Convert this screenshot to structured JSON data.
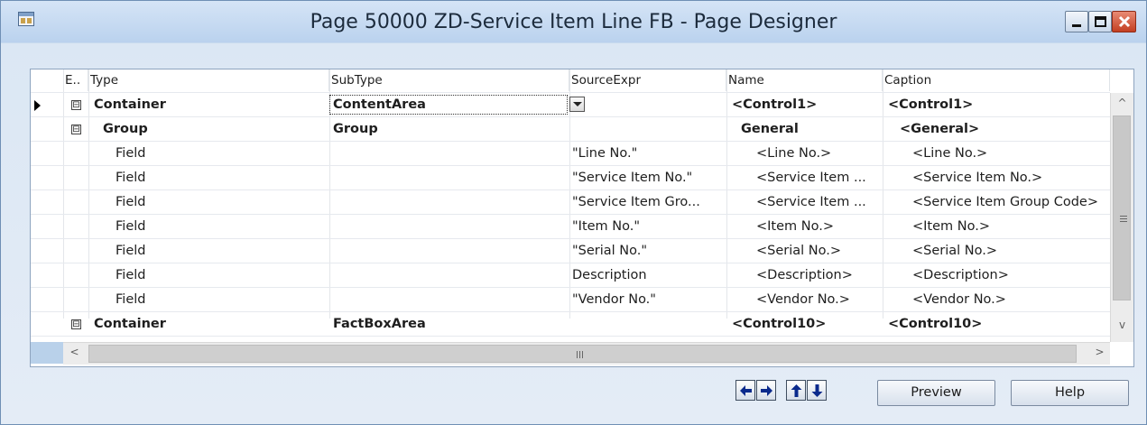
{
  "window": {
    "title": "Page 50000 ZD-Service Item Line FB - Page Designer",
    "icons": {
      "app": "page-designer-icon",
      "minimize": "minimize-icon",
      "maximize": "maximize-icon",
      "close": "close-icon"
    }
  },
  "grid": {
    "columns": [
      {
        "key": "expand",
        "label": "E.."
      },
      {
        "key": "type",
        "label": "Type"
      },
      {
        "key": "subtype",
        "label": "SubType"
      },
      {
        "key": "sourceexpr",
        "label": "SourceExpr"
      },
      {
        "key": "name",
        "label": "Name"
      },
      {
        "key": "caption",
        "label": "Caption"
      }
    ],
    "rows": [
      {
        "type": "Container",
        "subtype": "ContentArea",
        "sourceexpr": "",
        "name": "<Control1>",
        "caption": "<Control1>",
        "expander": "⊟",
        "current": true
      },
      {
        "type": "Group",
        "subtype": "Group",
        "sourceexpr": "",
        "name": "General",
        "caption": "<General>",
        "expander": "⊟"
      },
      {
        "type": "Field",
        "subtype": "",
        "sourceexpr": "\"Line No.\"",
        "name": "<Line No.>",
        "caption": "<Line No.>"
      },
      {
        "type": "Field",
        "subtype": "",
        "sourceexpr": "\"Service Item No.\"",
        "name": "<Service Item ...",
        "caption": "<Service Item No.>"
      },
      {
        "type": "Field",
        "subtype": "",
        "sourceexpr": "\"Service Item Gro...",
        "name": "<Service Item ...",
        "caption": "<Service Item Group Code>"
      },
      {
        "type": "Field",
        "subtype": "",
        "sourceexpr": "\"Item No.\"",
        "name": "<Item No.>",
        "caption": "<Item No.>"
      },
      {
        "type": "Field",
        "subtype": "",
        "sourceexpr": "\"Serial No.\"",
        "name": "<Serial No.>",
        "caption": "<Serial No.>"
      },
      {
        "type": "Field",
        "subtype": "",
        "sourceexpr": "Description",
        "name": "<Description>",
        "caption": "<Description>"
      },
      {
        "type": "Field",
        "subtype": "",
        "sourceexpr": "\"Vendor No.\"",
        "name": "<Vendor No.>",
        "caption": "<Vendor No.>"
      },
      {
        "type": "Container",
        "subtype": "FactBoxArea",
        "sourceexpr": "",
        "name": "<Control10>",
        "caption": "<Control10>",
        "expander": "⊟"
      }
    ],
    "scroll": {
      "up": "^",
      "down": "v",
      "left": "<",
      "right": ">",
      "hgrip": "III",
      "vgrip": "≡"
    }
  },
  "footer": {
    "nav_icons": [
      "arrow-left-icon",
      "arrow-right-icon",
      "arrow-up-icon",
      "arrow-down-icon"
    ],
    "preview_label": "Preview",
    "help_label": "Help"
  }
}
